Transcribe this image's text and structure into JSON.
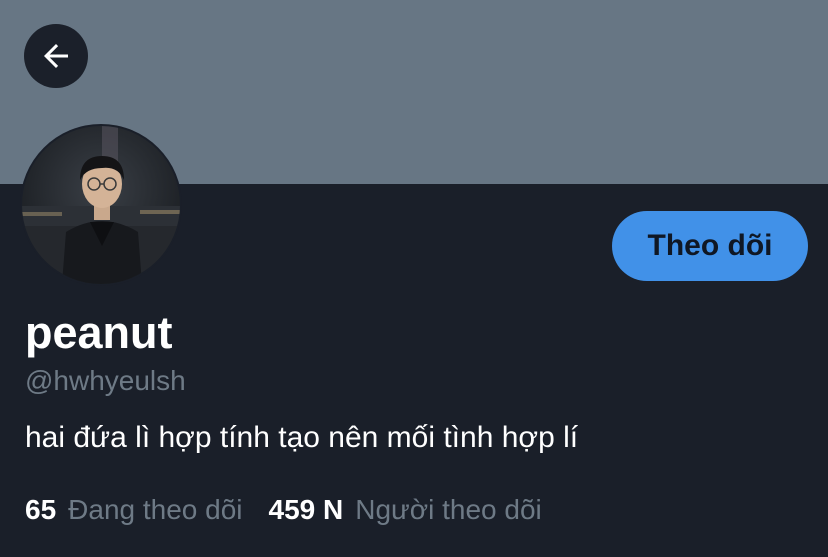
{
  "profile": {
    "display_name": "peanut",
    "handle": "@hwhyeulsh",
    "bio": "hai đứa lì hợp tính tạo nên mối tình hợp lí",
    "follow_label": "Theo dõi"
  },
  "stats": {
    "following_count": "65",
    "following_label": "Đang theo dõi",
    "followers_count": "459 N",
    "followers_label": "Người theo dõi"
  },
  "icons": {
    "back": "arrow-left-icon"
  },
  "colors": {
    "background": "#1a1f29",
    "banner": "#677684",
    "accent": "#4191e8",
    "secondary_text": "#6e7a86"
  }
}
